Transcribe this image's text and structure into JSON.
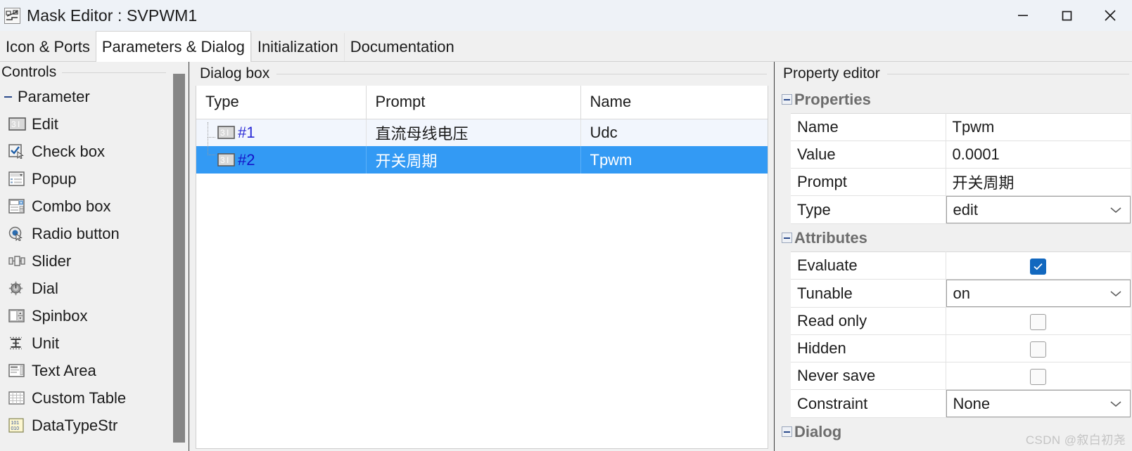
{
  "window": {
    "title": "Mask Editor : SVPWM1",
    "icon": "mask-editor-icon",
    "buttons": {
      "minimize": "minimize-icon",
      "maximize": "maximize-icon",
      "close": "close-icon"
    }
  },
  "tabs": [
    {
      "label": "Icon & Ports",
      "active": false
    },
    {
      "label": "Parameters & Dialog",
      "active": true
    },
    {
      "label": "Initialization",
      "active": false
    },
    {
      "label": "Documentation",
      "active": false
    }
  ],
  "controls_pane": {
    "title": "Controls",
    "group": {
      "label": "Parameter",
      "expanded": true
    },
    "items": [
      {
        "label": "Edit",
        "icon": "edit-field-icon"
      },
      {
        "label": "Check box",
        "icon": "check-box-icon"
      },
      {
        "label": "Popup",
        "icon": "popup-icon"
      },
      {
        "label": "Combo box",
        "icon": "combo-box-icon"
      },
      {
        "label": "Radio button",
        "icon": "radio-button-icon"
      },
      {
        "label": "Slider",
        "icon": "slider-icon"
      },
      {
        "label": "Dial",
        "icon": "dial-icon"
      },
      {
        "label": "Spinbox",
        "icon": "spinbox-icon"
      },
      {
        "label": "Unit",
        "icon": "unit-icon"
      },
      {
        "label": "Text Area",
        "icon": "text-area-icon"
      },
      {
        "label": "Custom Table",
        "icon": "custom-table-icon"
      },
      {
        "label": "DataTypeStr",
        "icon": "datatypestr-icon"
      }
    ]
  },
  "dialog_pane": {
    "title": "Dialog box",
    "columns": [
      "Type",
      "Prompt",
      "Name"
    ],
    "rows": [
      {
        "index": "#1",
        "icon": "edit-field-icon",
        "prompt": "直流母线电压",
        "name": "Udc",
        "selected": false
      },
      {
        "index": "#2",
        "icon": "edit-field-icon",
        "prompt": "开关周期",
        "name": "Tpwm",
        "selected": true
      }
    ]
  },
  "property_pane": {
    "title": "Property editor",
    "sections": [
      {
        "name": "Properties",
        "expanded": true,
        "rows": [
          {
            "key": "Name",
            "value": "Tpwm",
            "kind": "text"
          },
          {
            "key": "Value",
            "value": "0.0001",
            "kind": "text"
          },
          {
            "key": "Prompt",
            "value": "开关周期",
            "kind": "text"
          },
          {
            "key": "Type",
            "value": "edit",
            "kind": "select"
          }
        ]
      },
      {
        "name": "Attributes",
        "expanded": true,
        "rows": [
          {
            "key": "Evaluate",
            "value": "",
            "kind": "checkbox",
            "checked": true
          },
          {
            "key": "Tunable",
            "value": "on",
            "kind": "select"
          },
          {
            "key": "Read only",
            "value": "",
            "kind": "checkbox",
            "checked": false
          },
          {
            "key": "Hidden",
            "value": "",
            "kind": "checkbox",
            "checked": false
          },
          {
            "key": "Never save",
            "value": "",
            "kind": "checkbox",
            "checked": false
          },
          {
            "key": "Constraint",
            "value": "None",
            "kind": "select"
          }
        ]
      },
      {
        "name": "Dialog",
        "expanded": true,
        "rows": []
      }
    ]
  },
  "watermark": "CSDN @叙白初尧",
  "colors": {
    "selection_blue": "#339af4",
    "checkbox_blue": "#1268bf",
    "index_blue": "#2a2ad6",
    "titlebar": "#eef2f7",
    "pane_bg": "#f0f0f0"
  }
}
